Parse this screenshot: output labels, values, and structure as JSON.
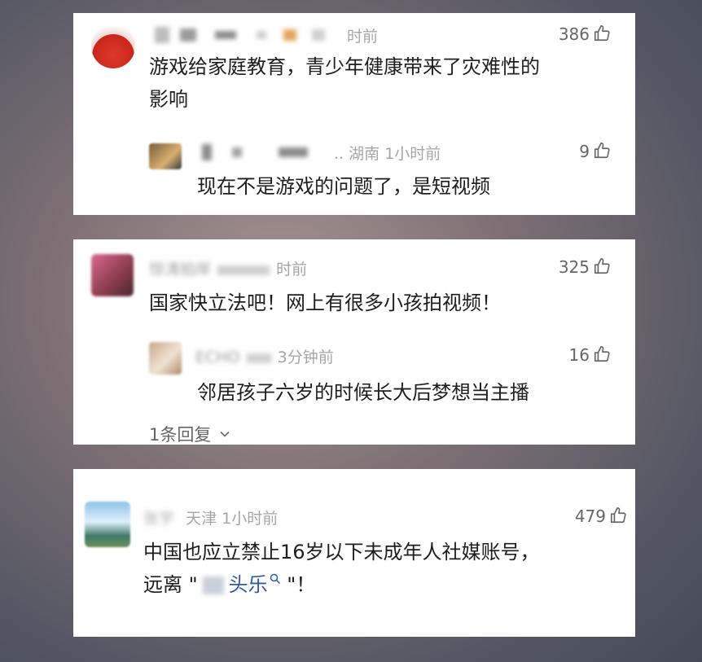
{
  "comments": [
    {
      "time": "时前",
      "likes": "386",
      "lines": [
        "游戏给家庭教育，青少年健康带来了灾难性的",
        "影响"
      ],
      "reply": {
        "user_suffix": "..",
        "location": "湖南",
        "time": "1小时前",
        "likes": "9",
        "text": "现在不是游戏的问题了，是短视频"
      }
    },
    {
      "username": "惊涛拍岸",
      "time": "时前",
      "likes": "325",
      "text": "国家快立法吧！网上有很多小孩拍视频！",
      "reply": {
        "username": "ECHO",
        "time": "3分钟前",
        "likes": "16",
        "text": "邻居孩子六岁的时候长大后梦想当主播"
      },
      "more_replies": "1条回复"
    },
    {
      "username": "张宇",
      "location": "天津",
      "time": "1小时前",
      "likes": "479",
      "line1": "中国也应立禁止16岁以下未成年人社媒账号，",
      "line2_prefix": "远离 \"",
      "line2_link": "头乐",
      "line2_suffix": " \"！"
    }
  ],
  "icons": {
    "like": "thumbs-up-icon",
    "search": "search-icon",
    "chevron": "chevron-down-icon"
  }
}
